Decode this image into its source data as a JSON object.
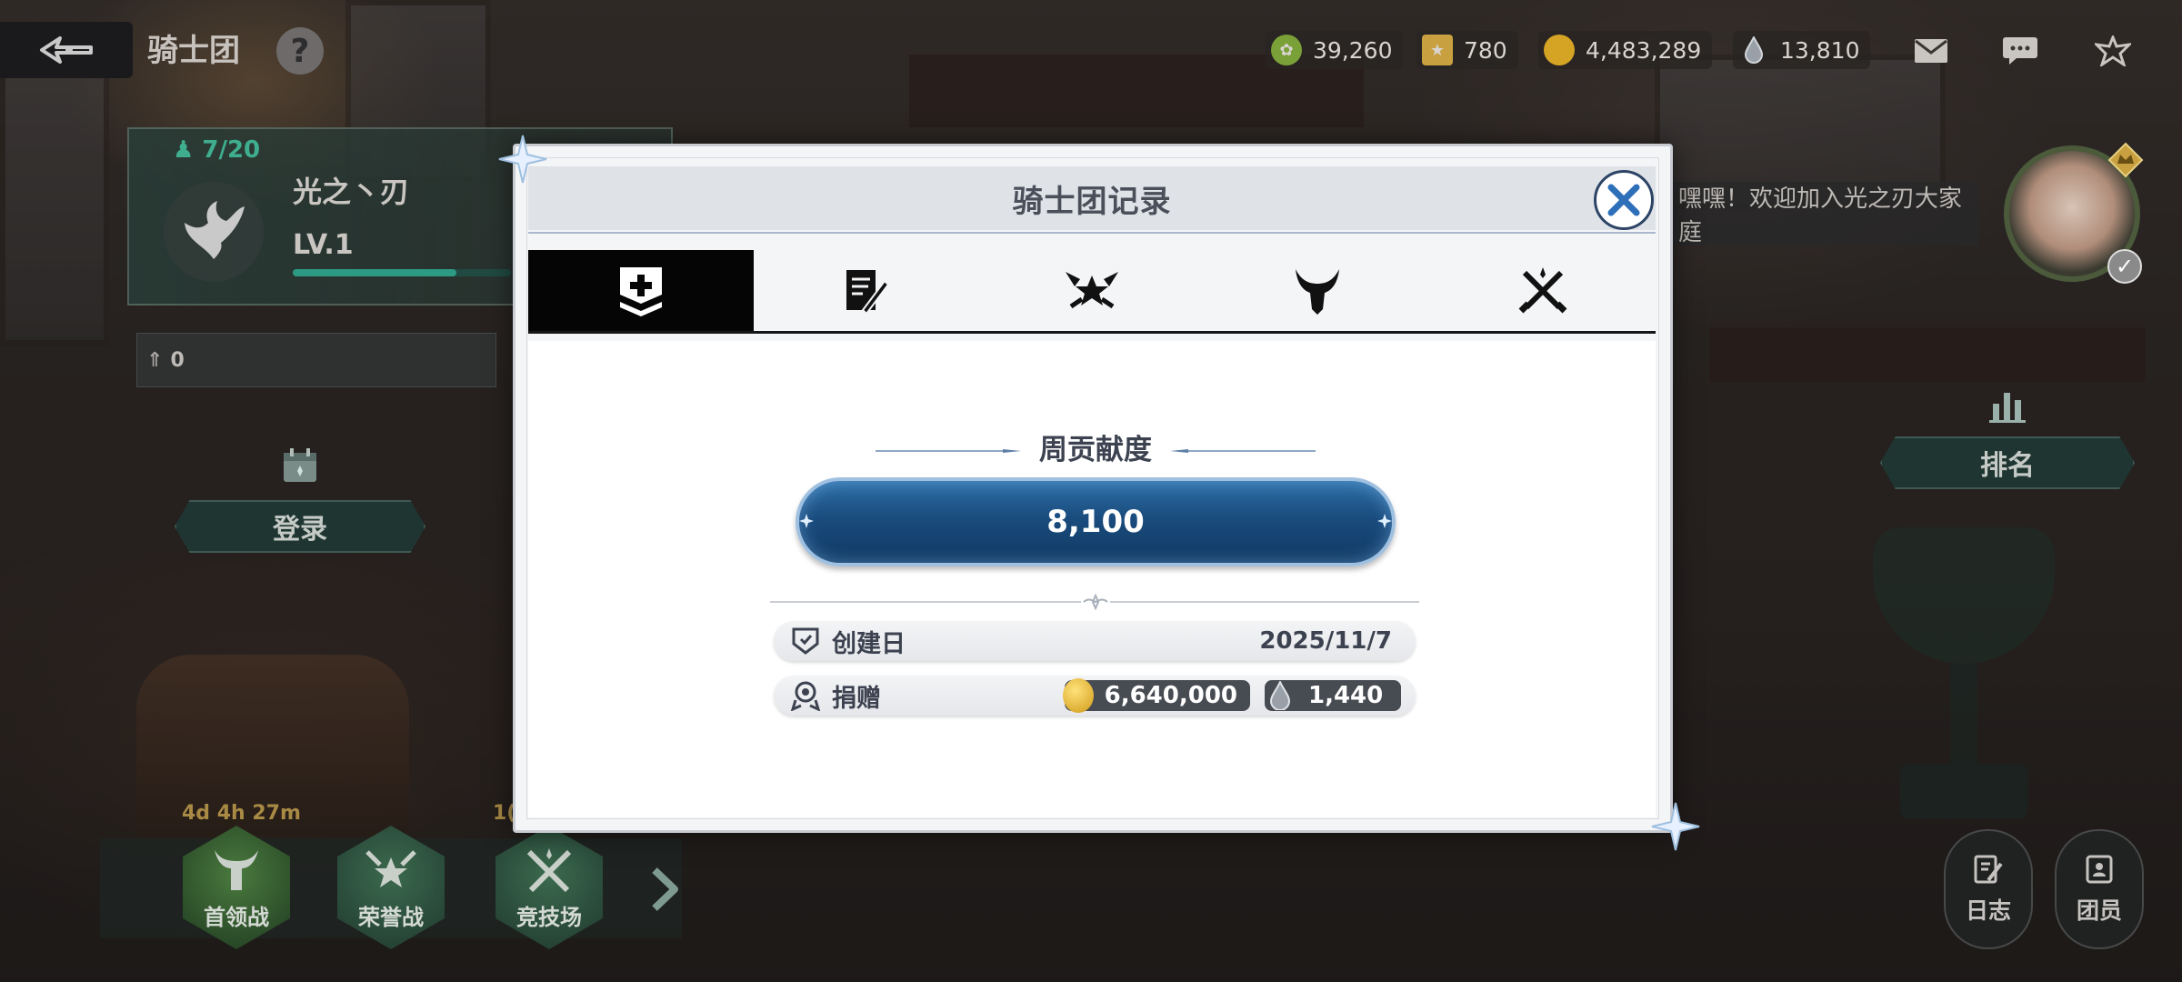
{
  "header": {
    "title": "骑士团",
    "help": "?"
  },
  "currencies": [
    {
      "icon": "green-coin-icon",
      "value": "39,260",
      "color": "#7aa038"
    },
    {
      "icon": "medal-icon",
      "value": "780",
      "color": "#c8a040"
    },
    {
      "icon": "gold-coin-icon",
      "value": "4,483,289",
      "color": "#d6a424"
    },
    {
      "icon": "crystal-drop-icon",
      "value": "13,810",
      "color": "#8a8f96"
    }
  ],
  "guild": {
    "members": "7/20",
    "name": "光之丶刃",
    "level": "LV.1",
    "xp_fraction": 0.75,
    "rank_value": "0"
  },
  "side_buttons": {
    "login": "登录",
    "ranking": "排名"
  },
  "chat_banner": "嘿嘿！欢迎加入光之刃大家庭",
  "dock": {
    "timer1": "4d 4h 27m",
    "timer2": "1(",
    "items": [
      {
        "label": "首领战"
      },
      {
        "label": "荣誉战"
      },
      {
        "label": "竞技场"
      }
    ]
  },
  "bottom_right": {
    "log": "日志",
    "members": "团员"
  },
  "modal": {
    "title": "骑士团记录",
    "tabs": [
      {
        "icon": "guild-shield-icon",
        "active": true
      },
      {
        "icon": "log-pen-icon",
        "active": false
      },
      {
        "icon": "honor-battle-icon",
        "active": false
      },
      {
        "icon": "boss-horns-icon",
        "active": false
      },
      {
        "icon": "arena-swords-icon",
        "active": false
      }
    ],
    "weekly_contribution_label": "周贡献度",
    "weekly_contribution_value": "8,100",
    "created_label": "创建日",
    "created_value": "2025/11/7",
    "donation_label": "捐赠",
    "donation_gold": "6,640,000",
    "donation_crystal": "1,440"
  },
  "colors": {
    "accent_blue": "#1a4c7e",
    "active_tab": "#050505",
    "guild_green": "#3fae8f"
  }
}
